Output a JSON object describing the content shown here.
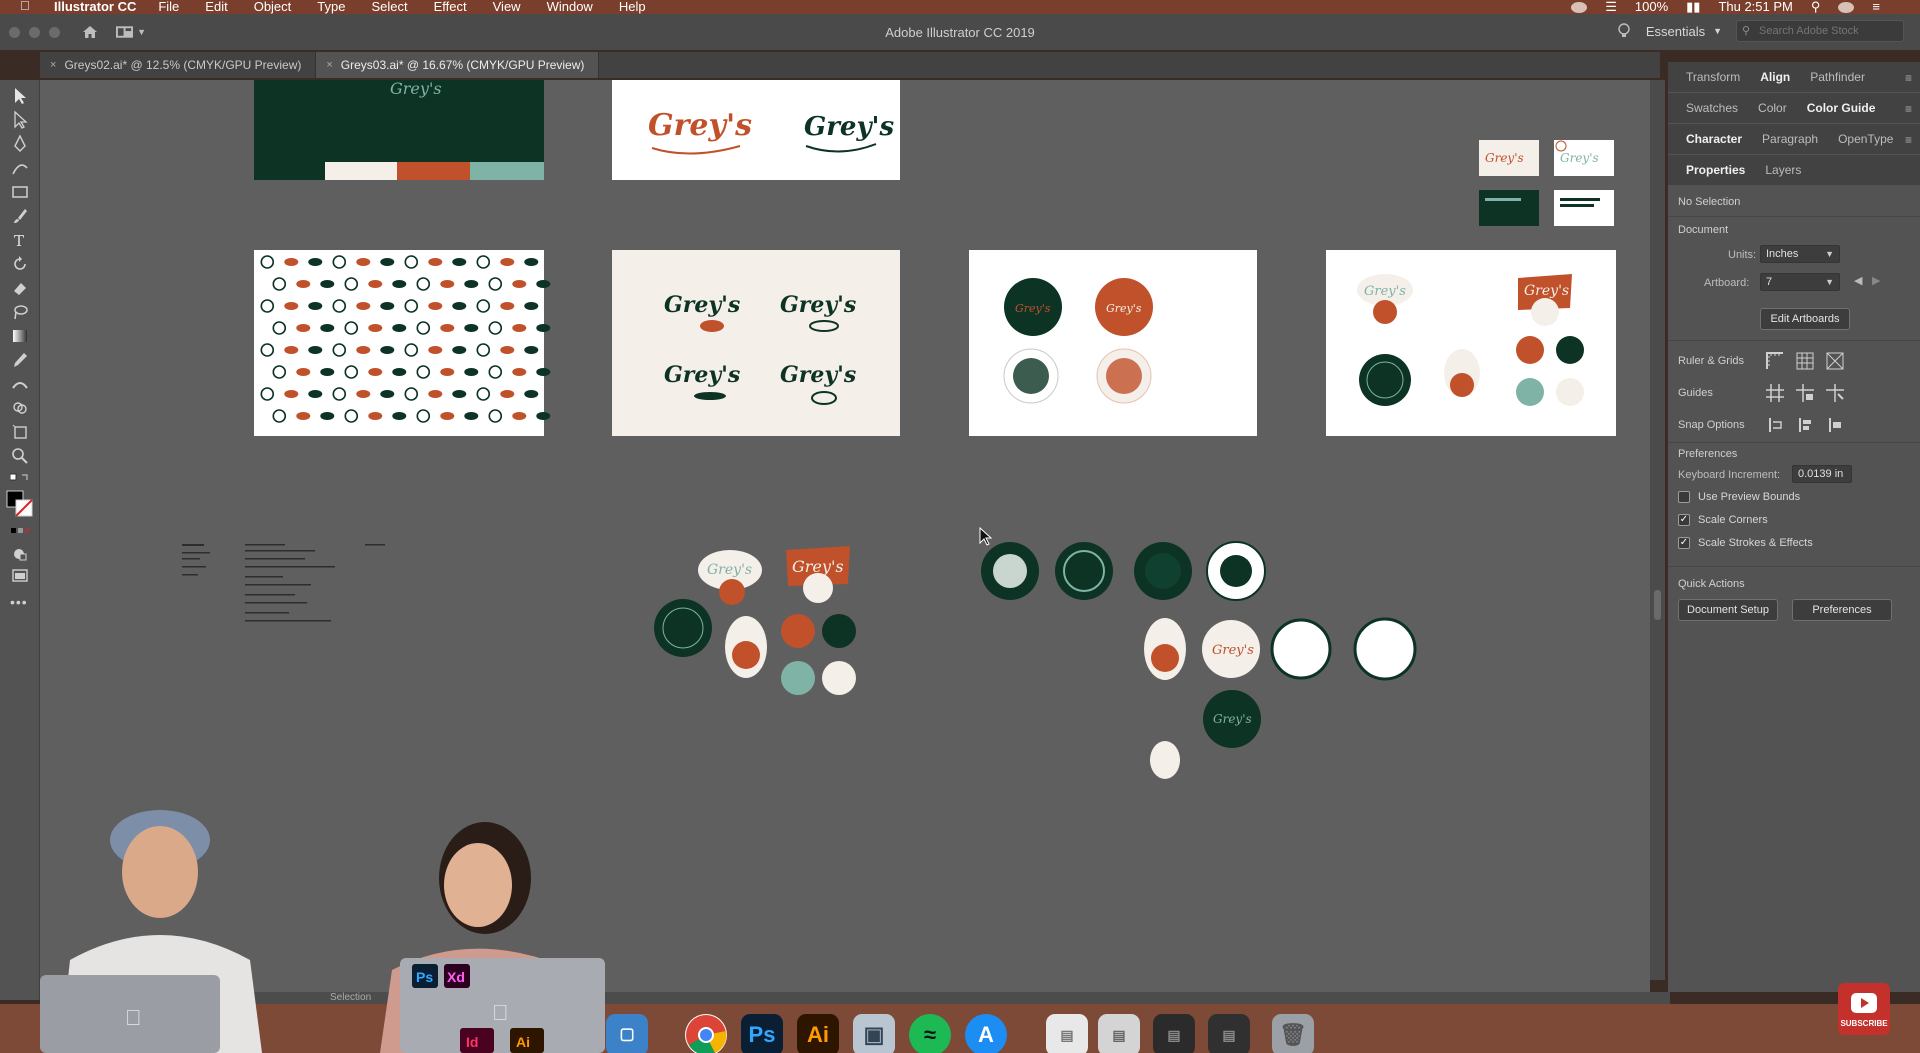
{
  "menubar": {
    "app_name": "Illustrator CC",
    "menus": [
      "File",
      "Edit",
      "Object",
      "Type",
      "Select",
      "Effect",
      "View",
      "Window",
      "Help"
    ],
    "battery": "100%",
    "clock": "Thu 2:51 PM"
  },
  "titlebar": {
    "window_title": "Adobe Illustrator CC 2019",
    "workspace": "Essentials",
    "stock_search_placeholder": "Search Adobe Stock"
  },
  "tabs": [
    {
      "label": "Greys02.ai* @ 12.5% (CMYK/GPU Preview)",
      "active": false
    },
    {
      "label": "Greys03.ai* @ 16.67% (CMYK/GPU Preview)",
      "active": true
    }
  ],
  "panels": {
    "group1": {
      "tabs": [
        "Transform",
        "Align",
        "Pathfinder"
      ],
      "active": "Align"
    },
    "group2": {
      "tabs": [
        "Swatches",
        "Color",
        "Color Guide"
      ],
      "active": "Color Guide"
    },
    "group3": {
      "tabs": [
        "Character",
        "Paragraph",
        "OpenType"
      ],
      "active": "Character"
    },
    "group4": {
      "tabs": [
        "Properties",
        "Layers"
      ],
      "active": "Properties"
    },
    "properties": {
      "selection": "No Selection",
      "document_heading": "Document",
      "units_label": "Units:",
      "units_value": "Inches",
      "artboard_label": "Artboard:",
      "artboard_value": "7",
      "edit_artboards": "Edit Artboards",
      "ruler_grids": "Ruler & Grids",
      "guides": "Guides",
      "snap_options": "Snap Options",
      "preferences_heading": "Preferences",
      "keyboard_increment_label": "Keyboard Increment:",
      "keyboard_increment_value": "0.0139 in",
      "use_preview_bounds": "Use Preview Bounds",
      "scale_corners": "Scale Corners",
      "scale_strokes": "Scale Strokes & Effects",
      "quick_actions": "Quick Actions",
      "document_setup": "Document Setup",
      "preferences_btn": "Preferences"
    },
    "checks": {
      "use_preview_bounds": false,
      "scale_corners": true,
      "scale_strokes": true
    }
  },
  "status": {
    "tool": "Selection"
  },
  "dock": {
    "ps": "Ps",
    "ai": "Ai",
    "id": "Id",
    "xd": "Xd"
  },
  "youtube": {
    "subscribe": "SUBSCRIBE"
  },
  "colors": {
    "forest": "#0c3324",
    "rust": "#c0512a",
    "sage": "#7fb3a6",
    "cream": "#f4efe9",
    "canvas": "#5f5f5f"
  }
}
